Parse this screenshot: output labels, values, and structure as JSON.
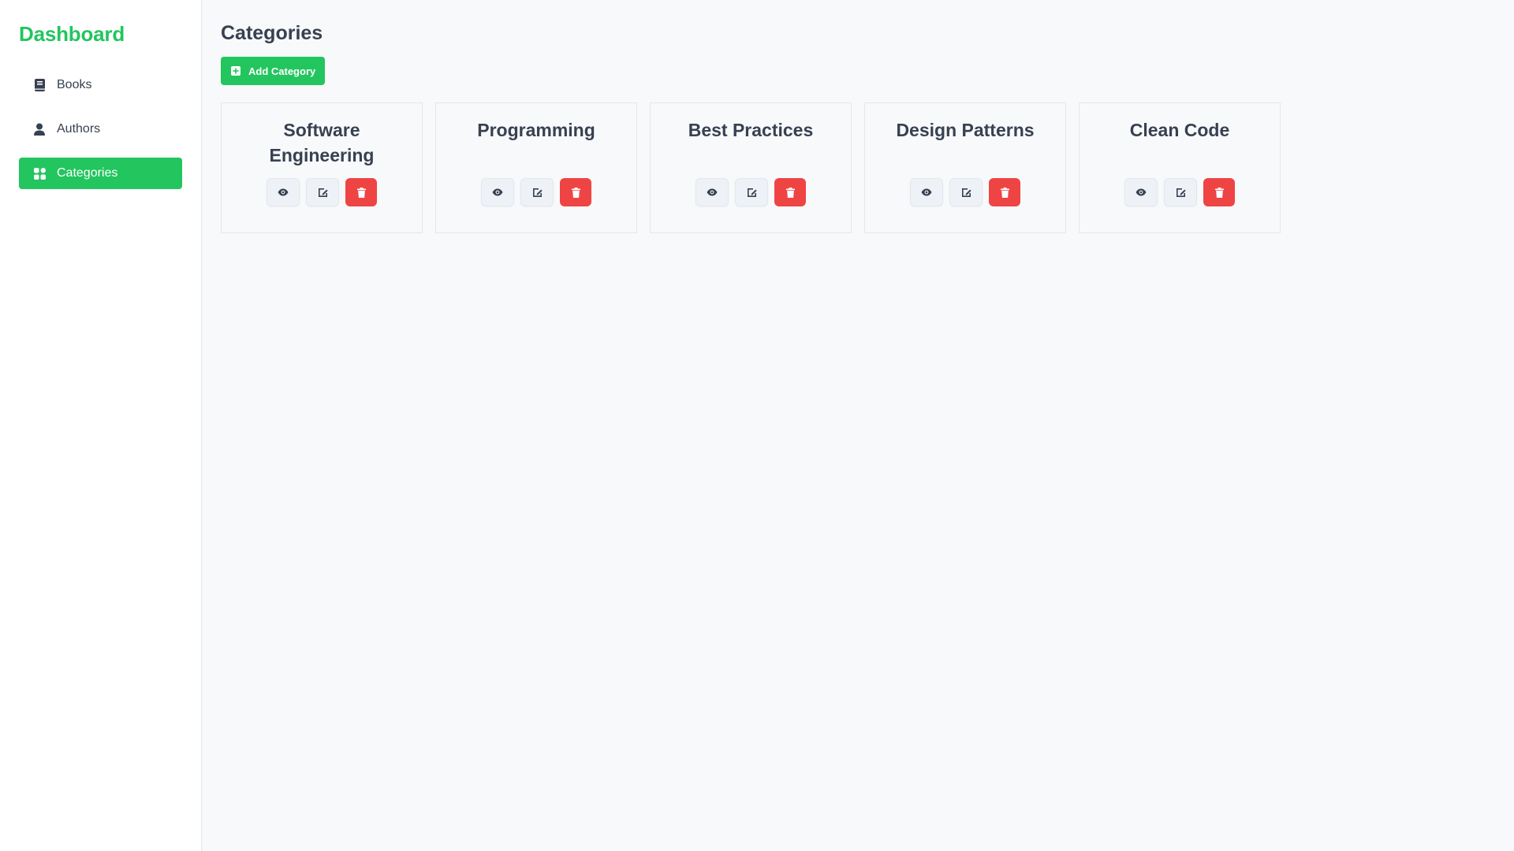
{
  "sidebar": {
    "brand": "Dashboard",
    "items": [
      {
        "label": "Books",
        "icon": "book-icon",
        "active": false
      },
      {
        "label": "Authors",
        "icon": "user-icon",
        "active": false
      },
      {
        "label": "Categories",
        "icon": "grid-icon",
        "active": true
      }
    ]
  },
  "main": {
    "title": "Categories",
    "add_label": "Add Category",
    "categories": [
      {
        "name": "Software Engineering"
      },
      {
        "name": "Programming"
      },
      {
        "name": "Best Practices"
      },
      {
        "name": "Design Patterns"
      },
      {
        "name": "Clean Code"
      }
    ]
  },
  "colors": {
    "accent": "#22c55e",
    "danger": "#ef4444",
    "text": "#374151",
    "background": "#f8f9fb"
  }
}
